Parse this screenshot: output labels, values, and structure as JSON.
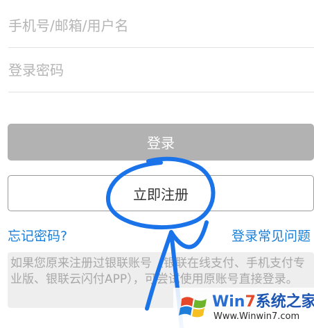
{
  "form": {
    "username_placeholder": "手机号/邮箱/用户名",
    "password_placeholder": "登录密码",
    "username_value": "",
    "password_value": ""
  },
  "buttons": {
    "login_label": "登录",
    "register_label": "立即注册"
  },
  "links": {
    "forgot_password": "忘记密码?",
    "login_faq": "登录常见问题"
  },
  "notice": {
    "text": "如果您原来注册过银联账号（银联在线支付、手机支付专业版、银联云闪付APP），可尝试使用原账号直接登录。"
  },
  "watermark": {
    "title_part1": "Win",
    "title_part2": "7",
    "title_part3": "系统之家",
    "url": "Www.Winwin7.com"
  },
  "colors": {
    "link": "#1c7fd7",
    "login_button_bg": "#b2b2b2",
    "annotation_stroke": "#1a73e8",
    "notice_bg": "#eeeeee"
  }
}
